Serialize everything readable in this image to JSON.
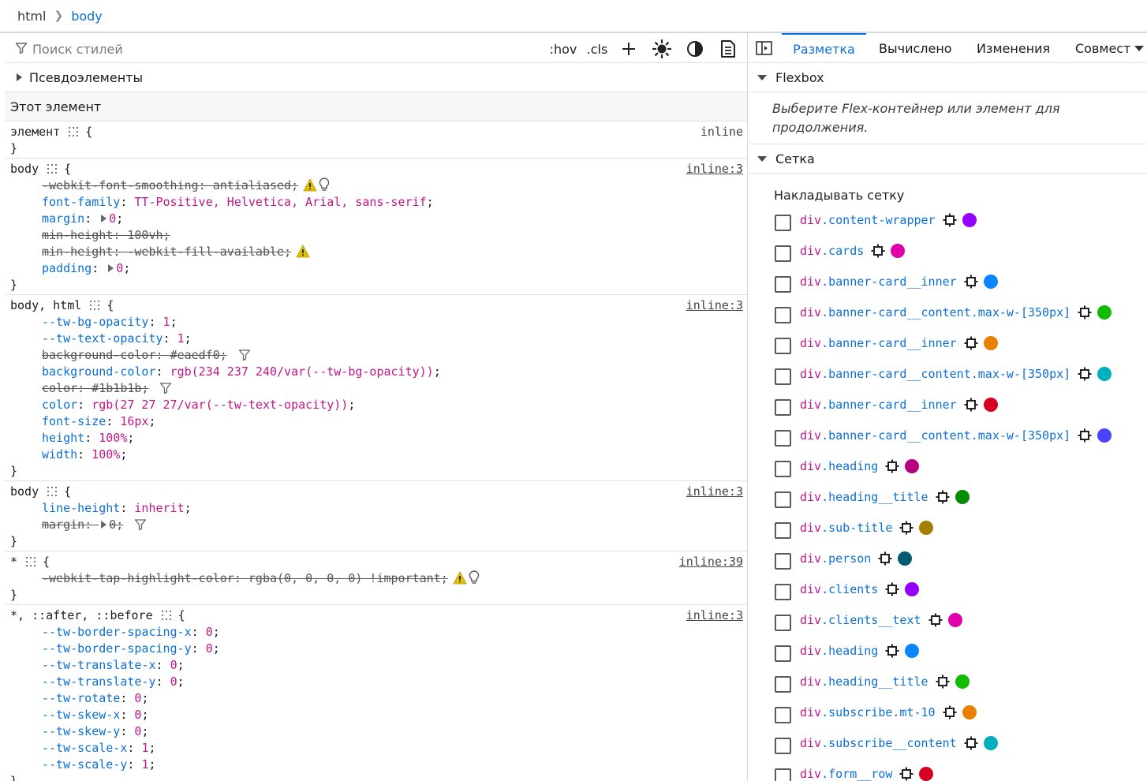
{
  "breadcrumbs": [
    "html",
    "body"
  ],
  "toolbar": {
    "filter_placeholder": "Поиск стилей",
    "hov": ":hov",
    "cls": ".cls",
    "add_rule": "+",
    "light_icon": "sun-icon",
    "dark_icon": "contrast-icon",
    "print_icon": "document-icon"
  },
  "pseudo_elements": "Псевдоэлементы",
  "this_element": "Этот элемент",
  "rules": [
    {
      "selector": "элемент",
      "source": "inline",
      "declarations": []
    },
    {
      "selector": "body",
      "source": "inline:3",
      "declarations": [
        {
          "name": "-webkit-font-smoothing",
          "value": "antialiased",
          "struck": true,
          "warn": true,
          "bulb": true
        },
        {
          "name": "font-family",
          "value": "TT-Positive, Helvetica, Arial, sans-serif"
        },
        {
          "name": "margin",
          "value": "0",
          "expander": true
        },
        {
          "name": "min-height",
          "value": "100vh",
          "struck": true
        },
        {
          "name": "min-height",
          "value": "-webkit-fill-available",
          "struck": true,
          "warn": true
        },
        {
          "name": "padding",
          "value": "0",
          "expander": true
        }
      ]
    },
    {
      "selector": "body, html",
      "source": "inline:3",
      "declarations": [
        {
          "name": "--tw-bg-opacity",
          "value": "1"
        },
        {
          "name": "--tw-text-opacity",
          "value": "1"
        },
        {
          "name": "background-color",
          "value": "#eaedf0",
          "struck": true,
          "filter": true
        },
        {
          "name": "background-color",
          "value": "rgb(234 237 240/var(--tw-bg-opacity))"
        },
        {
          "name": "color",
          "value": "#1b1b1b",
          "struck": true,
          "filter": true
        },
        {
          "name": "color",
          "value": "rgb(27 27 27/var(--tw-text-opacity))"
        },
        {
          "name": "font-size",
          "value": "16px"
        },
        {
          "name": "height",
          "value": "100%"
        },
        {
          "name": "width",
          "value": "100%"
        }
      ]
    },
    {
      "selector": "body",
      "source": "inline:3",
      "declarations": [
        {
          "name": "line-height",
          "value": "inherit"
        },
        {
          "name": "margin",
          "value": "0",
          "struck": true,
          "expander": true,
          "filter": true
        }
      ]
    },
    {
      "selector": "*",
      "source": "inline:39",
      "declarations": [
        {
          "name": "-webkit-tap-highlight-color",
          "value": "rgba(0, 0, 0, 0) !important",
          "struck": true,
          "warn": true,
          "bulb": true
        }
      ]
    },
    {
      "selector": "*, ::after, ::before",
      "source": "inline:3",
      "declarations": [
        {
          "name": "--tw-border-spacing-x",
          "value": "0"
        },
        {
          "name": "--tw-border-spacing-y",
          "value": "0"
        },
        {
          "name": "--tw-translate-x",
          "value": "0"
        },
        {
          "name": "--tw-translate-y",
          "value": "0"
        },
        {
          "name": "--tw-rotate",
          "value": "0"
        },
        {
          "name": "--tw-skew-x",
          "value": "0"
        },
        {
          "name": "--tw-skew-y",
          "value": "0"
        },
        {
          "name": "--tw-scale-x",
          "value": "1"
        },
        {
          "name": "--tw-scale-y",
          "value": "1"
        }
      ]
    }
  ],
  "right_tabs": [
    "Разметка",
    "Вычислено",
    "Изменения",
    "Совмест"
  ],
  "flexbox": {
    "title": "Flexbox",
    "hint": "Выберите Flex-контейнер или элемент для продолжения."
  },
  "grid": {
    "title": "Сетка",
    "overlay_title": "Накладывать сетку",
    "items": [
      {
        "tag": "div",
        "cls": ".content-wrapper",
        "color": "#9400ff"
      },
      {
        "tag": "div",
        "cls": ".cards",
        "color": "#df00a9"
      },
      {
        "tag": "div",
        "cls": ".banner-card__inner",
        "color": "#0a84ff"
      },
      {
        "tag": "div",
        "cls": ".banner-card__content.max-w-[350px]",
        "color": "#12bc00"
      },
      {
        "tag": "div",
        "cls": ".banner-card__inner",
        "color": "#ea8000"
      },
      {
        "tag": "div",
        "cls": ".banner-card__content.max-w-[350px]",
        "color": "#00b0bd"
      },
      {
        "tag": "div",
        "cls": ".banner-card__inner",
        "color": "#d70022"
      },
      {
        "tag": "div",
        "cls": ".banner-card__content.max-w-[350px]",
        "color": "#4b42ff"
      },
      {
        "tag": "div",
        "cls": ".heading",
        "color": "#b5007f"
      },
      {
        "tag": "div",
        "cls": ".heading__title",
        "color": "#058b00"
      },
      {
        "tag": "div",
        "cls": ".sub-title",
        "color": "#a47f00"
      },
      {
        "tag": "div",
        "cls": ".person",
        "color": "#005a71"
      },
      {
        "tag": "div",
        "cls": ".clients",
        "color": "#9400ff"
      },
      {
        "tag": "div",
        "cls": ".clients__text",
        "color": "#df00a9"
      },
      {
        "tag": "div",
        "cls": ".heading",
        "color": "#0a84ff"
      },
      {
        "tag": "div",
        "cls": ".heading__title",
        "color": "#12bc00"
      },
      {
        "tag": "div",
        "cls": ".subscribe.mt-10",
        "color": "#ea8000"
      },
      {
        "tag": "div",
        "cls": ".subscribe__content",
        "color": "#00b0bd"
      },
      {
        "tag": "div",
        "cls": ".form__row",
        "color": "#d70022"
      }
    ]
  }
}
